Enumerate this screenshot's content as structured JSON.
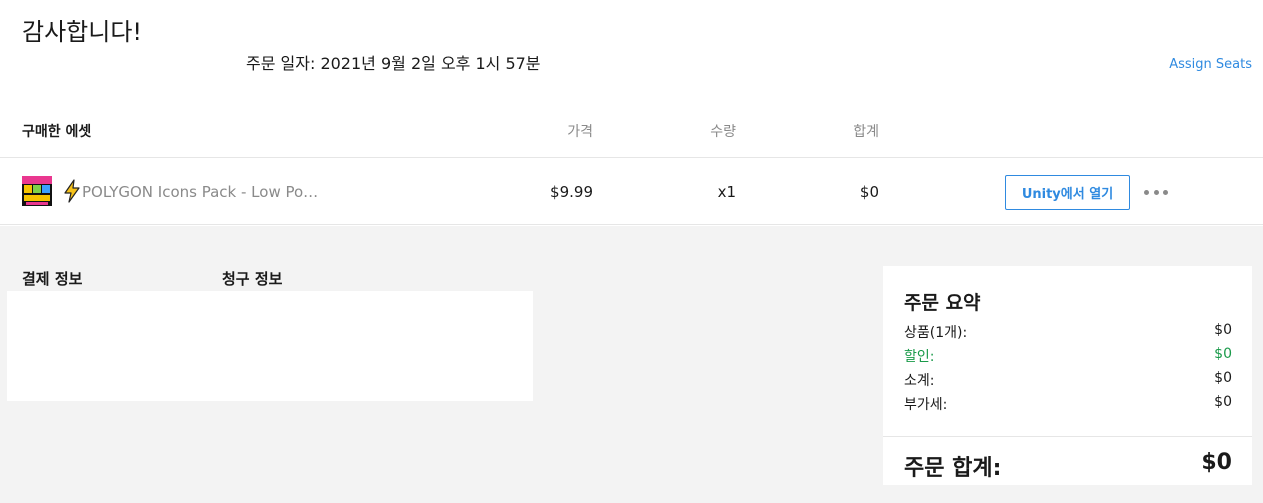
{
  "header": {
    "title": "감사합니다!",
    "order_date": "주문 일자: 2021년 9월 2일 오후 1시 57분",
    "assign_seats": "Assign Seats"
  },
  "table": {
    "headers": {
      "asset": "구매한 에셋",
      "price": "가격",
      "quantity": "수량",
      "total": "합계"
    },
    "rows": [
      {
        "name": "POLYGON Icons Pack - Low Po…",
        "price": "$9.99",
        "quantity": "x1",
        "total": "$0",
        "open_button": "Unity에서 열기",
        "icon": "lightning-icon"
      }
    ]
  },
  "billing": {
    "payment_label": "결제 정보",
    "billing_label": "청구 정보"
  },
  "summary": {
    "title": "주문 요약",
    "rows": [
      {
        "label": "상품(1개):",
        "value": "$0"
      },
      {
        "label": "할인:",
        "value": "$0"
      },
      {
        "label": "소계:",
        "value": "$0"
      },
      {
        "label": "부가세:",
        "value": "$0"
      }
    ],
    "grand_label": "주문 합계:",
    "grand_value": "$0"
  },
  "colors": {
    "accent": "#2f8ae0",
    "discount": "#1a9a4a",
    "muted": "#8a8a8a",
    "panel_bg": "#f3f3f3"
  }
}
